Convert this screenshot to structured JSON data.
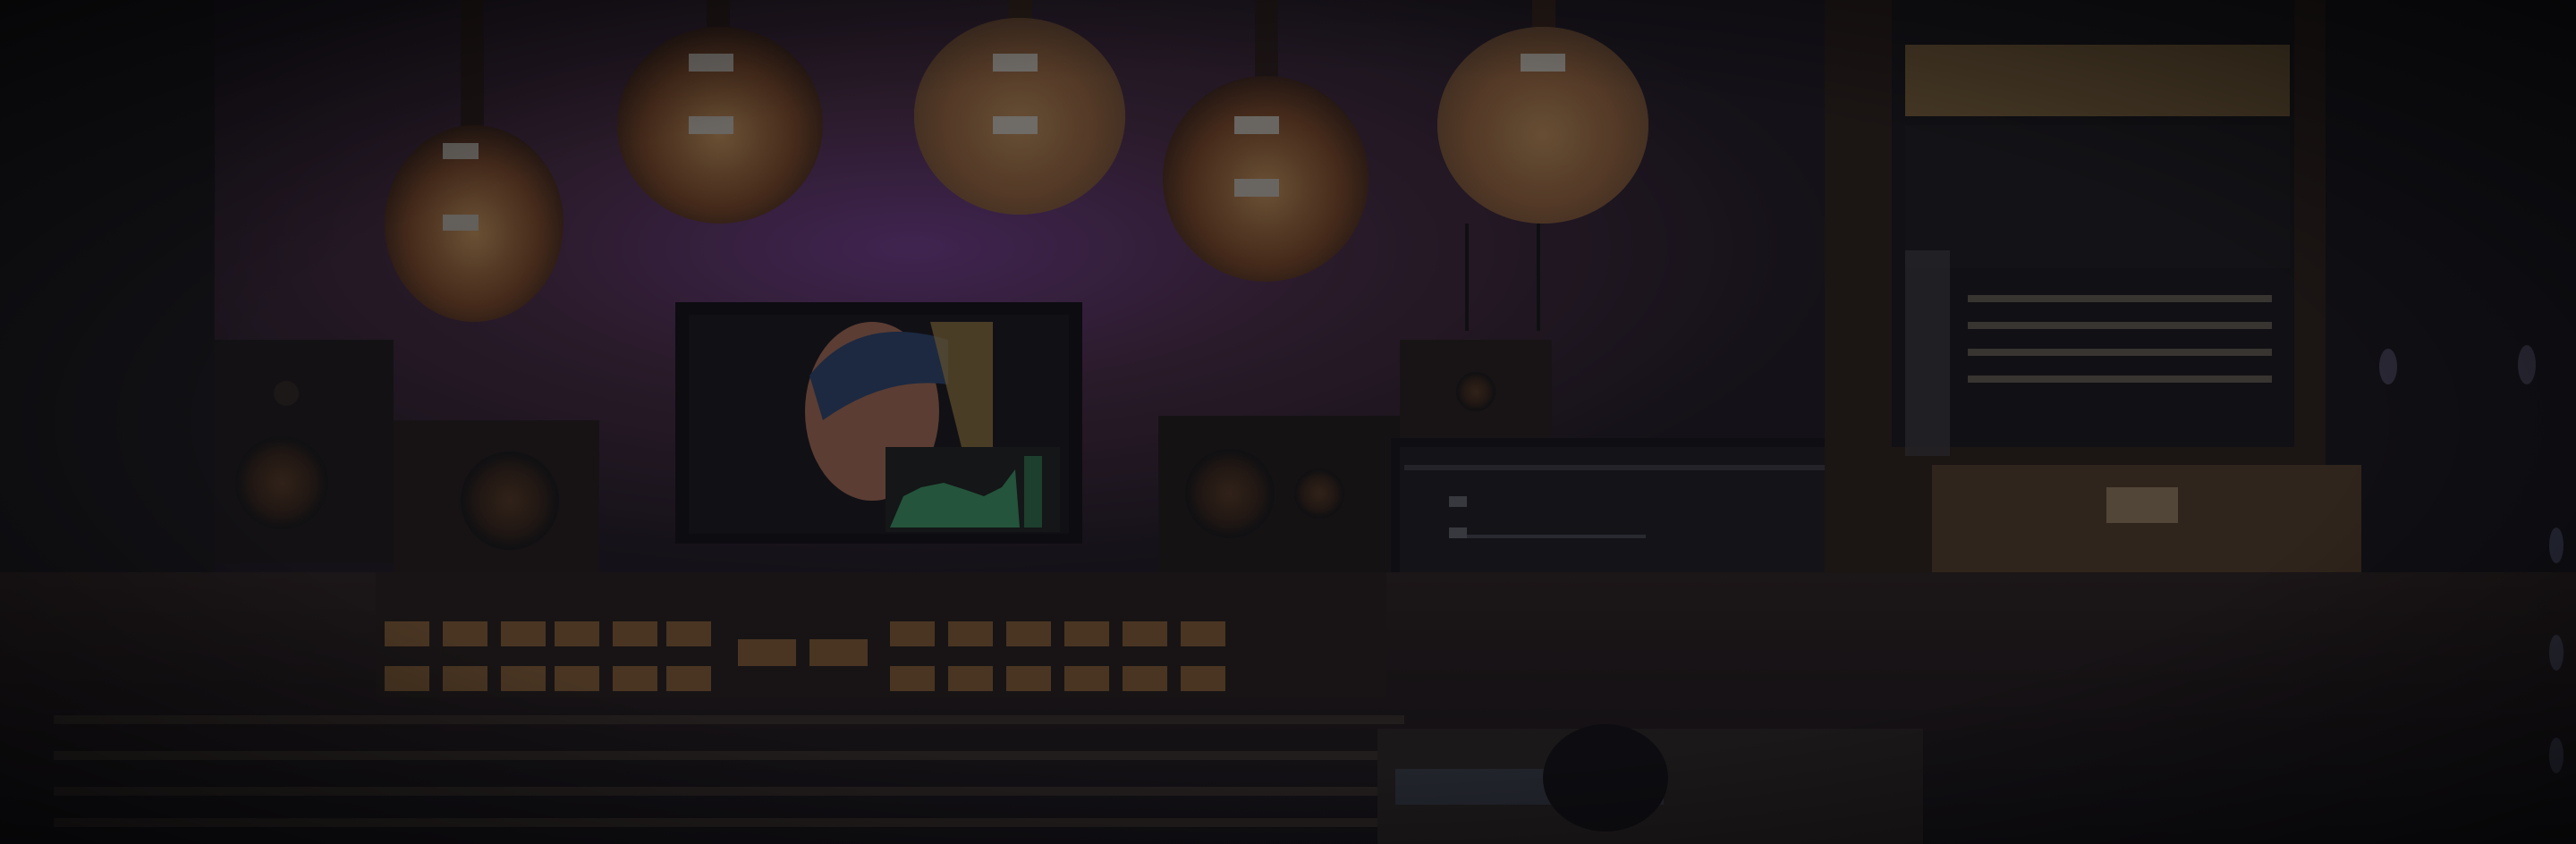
{
  "scene": {
    "subject": "music-recording-studio",
    "overlay_color": "#0f0e14",
    "accent_colors": {
      "wall_purple": "#7a3fa0",
      "wood": "#6a3a1e",
      "meter_green": "#3fa86a",
      "lamp_amber": "#e9a24a"
    },
    "guitar_count": 5,
    "monitor_count": 2
  }
}
